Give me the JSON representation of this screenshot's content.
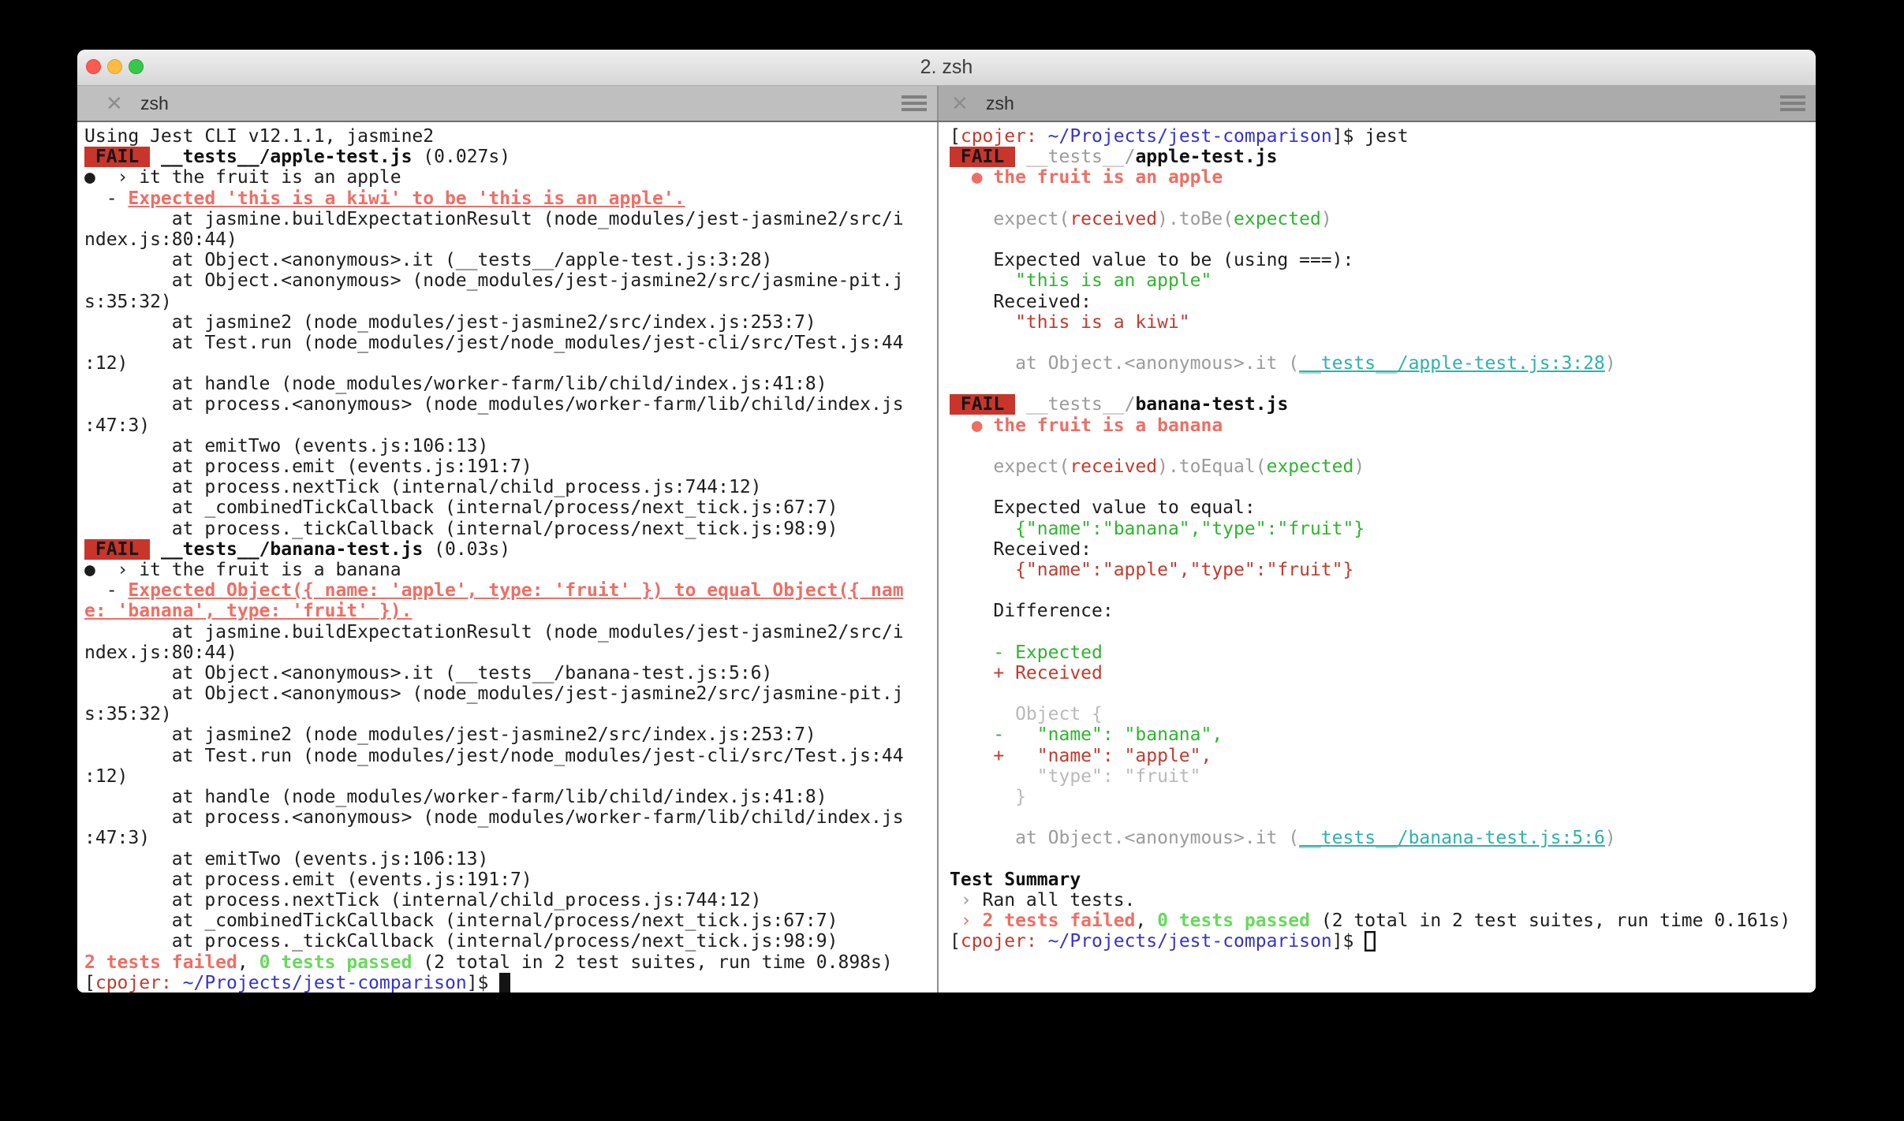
{
  "window": {
    "title": "2. zsh"
  },
  "tabs": {
    "left": {
      "label": "zsh",
      "close_glyph": "✕"
    },
    "right": {
      "label": "zsh",
      "close_glyph": "✕"
    }
  },
  "colors": {
    "fail_badge_bg": "#c9352b",
    "bright_red": "#ef6e64",
    "ansi_red": "#c5392c",
    "ansi_green": "#2db52d",
    "bright_green": "#68d95d",
    "path_blue": "#3432cf",
    "link_cyan": "#2fb0ab",
    "dim_gray": "#9b9b9b",
    "tab_active_bg": "#bfbfbf",
    "tab_inactive_bg": "#ababab"
  },
  "panes": {
    "left": {
      "lines": [
        [
          [
            "Using Jest CLI v12.1.1, jasmine2",
            "d"
          ]
        ],
        [
          [
            " FAIL ",
            "badge"
          ],
          [
            " ",
            "d"
          ],
          [
            "__tests__/apple-test.js",
            "b"
          ],
          [
            " (0.027s)",
            "d"
          ]
        ],
        [
          [
            "●  › it the fruit is an apple",
            "d"
          ]
        ],
        [
          [
            "  - ",
            "d"
          ],
          [
            "Expected 'this is a kiwi' to be 'this is an apple'.",
            "sU"
          ]
        ],
        [
          [
            "        at jasmine.buildExpectationResult (node_modules/jest-jasmine2/src/i",
            "d"
          ]
        ],
        [
          [
            "ndex.js:80:44)",
            "d"
          ]
        ],
        [
          [
            "        at Object.<anonymous>.it (__tests__/apple-test.js:3:28)",
            "d"
          ]
        ],
        [
          [
            "        at Object.<anonymous> (node_modules/jest-jasmine2/src/jasmine-pit.j",
            "d"
          ]
        ],
        [
          [
            "s:35:32)",
            "d"
          ]
        ],
        [
          [
            "        at jasmine2 (node_modules/jest-jasmine2/src/index.js:253:7)",
            "d"
          ]
        ],
        [
          [
            "        at Test.run (node_modules/jest/node_modules/jest-cli/src/Test.js:44",
            "d"
          ]
        ],
        [
          [
            ":12)",
            "d"
          ]
        ],
        [
          [
            "        at handle (node_modules/worker-farm/lib/child/index.js:41:8)",
            "d"
          ]
        ],
        [
          [
            "        at process.<anonymous> (node_modules/worker-farm/lib/child/index.js",
            "d"
          ]
        ],
        [
          [
            ":47:3)",
            "d"
          ]
        ],
        [
          [
            "        at emitTwo (events.js:106:13)",
            "d"
          ]
        ],
        [
          [
            "        at process.emit (events.js:191:7)",
            "d"
          ]
        ],
        [
          [
            "        at process.nextTick (internal/child_process.js:744:12)",
            "d"
          ]
        ],
        [
          [
            "        at _combinedTickCallback (internal/process/next_tick.js:67:7)",
            "d"
          ]
        ],
        [
          [
            "        at process._tickCallback (internal/process/next_tick.js:98:9)",
            "d"
          ]
        ],
        [
          [
            " FAIL ",
            "badge"
          ],
          [
            " ",
            "d"
          ],
          [
            "__tests__/banana-test.js",
            "b"
          ],
          [
            " (0.03s)",
            "d"
          ]
        ],
        [
          [
            "●  › it the fruit is a banana",
            "d"
          ]
        ],
        [
          [
            "  - ",
            "d"
          ],
          [
            "Expected Object({ name: 'apple', type: 'fruit' }) to equal Object({ nam",
            "sU"
          ]
        ],
        [
          [
            "e: 'banana', type: 'fruit' }).",
            "sU"
          ]
        ],
        [
          [
            "        at jasmine.buildExpectationResult (node_modules/jest-jasmine2/src/i",
            "d"
          ]
        ],
        [
          [
            "ndex.js:80:44)",
            "d"
          ]
        ],
        [
          [
            "        at Object.<anonymous>.it (__tests__/banana-test.js:5:6)",
            "d"
          ]
        ],
        [
          [
            "        at Object.<anonymous> (node_modules/jest-jasmine2/src/jasmine-pit.j",
            "d"
          ]
        ],
        [
          [
            "s:35:32)",
            "d"
          ]
        ],
        [
          [
            "        at jasmine2 (node_modules/jest-jasmine2/src/index.js:253:7)",
            "d"
          ]
        ],
        [
          [
            "        at Test.run (node_modules/jest/node_modules/jest-cli/src/Test.js:44",
            "d"
          ]
        ],
        [
          [
            ":12)",
            "d"
          ]
        ],
        [
          [
            "        at handle (node_modules/worker-farm/lib/child/index.js:41:8)",
            "d"
          ]
        ],
        [
          [
            "        at process.<anonymous> (node_modules/worker-farm/lib/child/index.js",
            "d"
          ]
        ],
        [
          [
            ":47:3)",
            "d"
          ]
        ],
        [
          [
            "        at emitTwo (events.js:106:13)",
            "d"
          ]
        ],
        [
          [
            "        at process.emit (events.js:191:7)",
            "d"
          ]
        ],
        [
          [
            "        at process.nextTick (internal/child_process.js:744:12)",
            "d"
          ]
        ],
        [
          [
            "        at _combinedTickCallback (internal/process/next_tick.js:67:7)",
            "d"
          ]
        ],
        [
          [
            "        at process._tickCallback (internal/process/next_tick.js:98:9)",
            "d"
          ]
        ],
        [
          [
            "2 tests failed",
            "s"
          ],
          [
            ", ",
            "d"
          ],
          [
            "0 tests passed",
            "bg"
          ],
          [
            " (2 total in 2 test suites, run time 0.898s)",
            "d"
          ]
        ],
        [
          [
            "[",
            "d"
          ],
          [
            "cpojer:",
            "pr"
          ],
          [
            " ",
            "d"
          ],
          [
            "~/Projects/jest-comparison",
            "bl"
          ],
          [
            "]$ ",
            "d"
          ],
          [
            " ",
            "cur"
          ]
        ]
      ]
    },
    "right": {
      "lines": [
        [
          [
            "[",
            "d"
          ],
          [
            "cpojer:",
            "pr"
          ],
          [
            " ",
            "d"
          ],
          [
            "~/Projects/jest-comparison",
            "bl"
          ],
          [
            "]$ jest",
            "d"
          ]
        ],
        [
          [
            " FAIL ",
            "badge"
          ],
          [
            " ",
            "d"
          ],
          [
            "__tests__/",
            "dim"
          ],
          [
            "apple-test.js",
            "b"
          ]
        ],
        [
          [
            "  ● ",
            "sp"
          ],
          [
            "the fruit is an apple",
            "s"
          ]
        ],
        [],
        [
          [
            "    expect(",
            "dim"
          ],
          [
            "received",
            "red"
          ],
          [
            ").toBe(",
            "dim"
          ],
          [
            "expected",
            "grn"
          ],
          [
            ")",
            "dim"
          ]
        ],
        [],
        [
          [
            "    Expected value to be (using ===):",
            "d"
          ]
        ],
        [
          [
            "      \"this is an apple\"",
            "grn"
          ]
        ],
        [
          [
            "    Received:",
            "d"
          ]
        ],
        [
          [
            "      \"this is a kiwi\"",
            "red"
          ]
        ],
        [],
        [
          [
            "      at Object.<anonymous>.it (",
            "dim"
          ],
          [
            "__tests__/apple-test.js:3:28",
            "cy"
          ],
          [
            ")",
            "dim"
          ]
        ],
        [],
        [
          [
            " FAIL ",
            "badge"
          ],
          [
            " ",
            "d"
          ],
          [
            "__tests__/",
            "dim"
          ],
          [
            "banana-test.js",
            "b"
          ]
        ],
        [
          [
            "  ● ",
            "sp"
          ],
          [
            "the fruit is a banana",
            "s"
          ]
        ],
        [],
        [
          [
            "    expect(",
            "dim"
          ],
          [
            "received",
            "red"
          ],
          [
            ").toEqual(",
            "dim"
          ],
          [
            "expected",
            "grn"
          ],
          [
            ")",
            "dim"
          ]
        ],
        [],
        [
          [
            "    Expected value to equal:",
            "d"
          ]
        ],
        [
          [
            "      {\"name\":\"banana\",\"type\":\"fruit\"}",
            "grn"
          ]
        ],
        [
          [
            "    Received:",
            "d"
          ]
        ],
        [
          [
            "      {\"name\":\"apple\",\"type\":\"fruit\"}",
            "red"
          ]
        ],
        [],
        [
          [
            "    Difference:",
            "d"
          ]
        ],
        [],
        [
          [
            "    - Expected",
            "grn"
          ]
        ],
        [
          [
            "    + Received",
            "red"
          ]
        ],
        [],
        [
          [
            "      Object {",
            "diml"
          ]
        ],
        [
          [
            "    -   \"name\": \"banana\",",
            "grn"
          ]
        ],
        [
          [
            "    +   \"name\": \"apple\",",
            "red"
          ]
        ],
        [
          [
            "        \"type\": \"fruit\"",
            "diml"
          ]
        ],
        [
          [
            "      }",
            "diml"
          ]
        ],
        [],
        [
          [
            "      at Object.<anonymous>.it (",
            "dim"
          ],
          [
            "__tests__/banana-test.js:5:6",
            "cy"
          ],
          [
            ")",
            "dim"
          ]
        ],
        [],
        [
          [
            "Test Summary",
            "b"
          ]
        ],
        [
          [
            " › ",
            "dim"
          ],
          [
            "Ran all tests.",
            "d"
          ]
        ],
        [
          [
            " › ",
            "sp"
          ],
          [
            "2 tests failed",
            "s"
          ],
          [
            ", ",
            "d"
          ],
          [
            "0 tests passed",
            "bg"
          ],
          [
            " (2 total in 2 test suites, run time 0.161s)",
            "d"
          ]
        ],
        [
          [
            "[",
            "d"
          ],
          [
            "cpojer:",
            "pr"
          ],
          [
            " ",
            "d"
          ],
          [
            "~/Projects/jest-comparison",
            "bl"
          ],
          [
            "]$ ",
            "d"
          ],
          [
            " ",
            "curh"
          ]
        ]
      ]
    }
  }
}
